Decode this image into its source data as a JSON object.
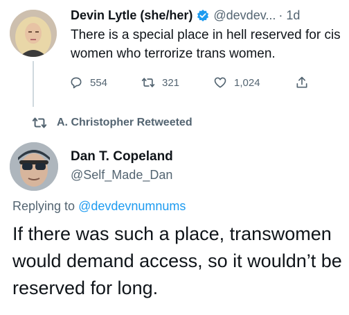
{
  "original_tweet": {
    "name": "Devin Lytle (she/her)",
    "handle": "@devdev...",
    "time": "· 1d",
    "text": "There is a special place in hell reserved for cis women who terrorize trans women.",
    "reply_count": "554",
    "retweet_count": "321",
    "like_count": "1,024",
    "icons": {
      "verified": "verified-badge-icon",
      "reply": "reply-icon",
      "retweet": "retweet-icon",
      "like": "heart-icon",
      "share": "share-icon"
    }
  },
  "retweet_banner": {
    "label": "A. Christopher Retweeted",
    "icon": "retweet-icon"
  },
  "reply_tweet": {
    "name": "Dan T. Copeland",
    "handle": "@Self_Made_Dan",
    "replying_prefix": "Replying to ",
    "replying_to": "@devdevnumnums",
    "text": "If there was such a place, transwomen would demand access, so it wouldn’t be reserved for long."
  },
  "colors": {
    "link": "#1d9bf0",
    "secondary": "#536471",
    "verified": "#1d9bf0"
  }
}
